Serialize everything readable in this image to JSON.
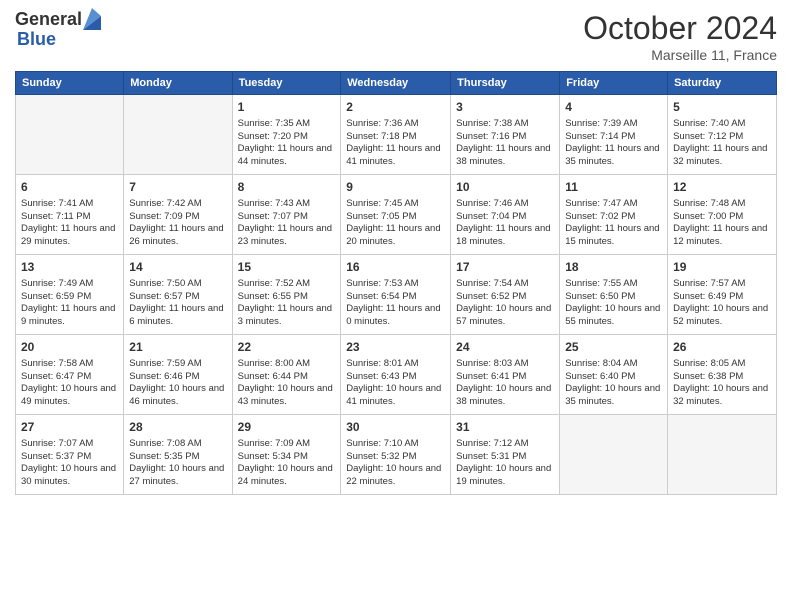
{
  "logo": {
    "general": "General",
    "blue": "Blue"
  },
  "header": {
    "title": "October 2024",
    "subtitle": "Marseille 11, France"
  },
  "weekdays": [
    "Sunday",
    "Monday",
    "Tuesday",
    "Wednesday",
    "Thursday",
    "Friday",
    "Saturday"
  ],
  "weeks": [
    [
      {
        "day": "",
        "sunrise": "",
        "sunset": "",
        "daylight": ""
      },
      {
        "day": "",
        "sunrise": "",
        "sunset": "",
        "daylight": ""
      },
      {
        "day": "1",
        "sunrise": "Sunrise: 7:35 AM",
        "sunset": "Sunset: 7:20 PM",
        "daylight": "Daylight: 11 hours and 44 minutes."
      },
      {
        "day": "2",
        "sunrise": "Sunrise: 7:36 AM",
        "sunset": "Sunset: 7:18 PM",
        "daylight": "Daylight: 11 hours and 41 minutes."
      },
      {
        "day": "3",
        "sunrise": "Sunrise: 7:38 AM",
        "sunset": "Sunset: 7:16 PM",
        "daylight": "Daylight: 11 hours and 38 minutes."
      },
      {
        "day": "4",
        "sunrise": "Sunrise: 7:39 AM",
        "sunset": "Sunset: 7:14 PM",
        "daylight": "Daylight: 11 hours and 35 minutes."
      },
      {
        "day": "5",
        "sunrise": "Sunrise: 7:40 AM",
        "sunset": "Sunset: 7:12 PM",
        "daylight": "Daylight: 11 hours and 32 minutes."
      }
    ],
    [
      {
        "day": "6",
        "sunrise": "Sunrise: 7:41 AM",
        "sunset": "Sunset: 7:11 PM",
        "daylight": "Daylight: 11 hours and 29 minutes."
      },
      {
        "day": "7",
        "sunrise": "Sunrise: 7:42 AM",
        "sunset": "Sunset: 7:09 PM",
        "daylight": "Daylight: 11 hours and 26 minutes."
      },
      {
        "day": "8",
        "sunrise": "Sunrise: 7:43 AM",
        "sunset": "Sunset: 7:07 PM",
        "daylight": "Daylight: 11 hours and 23 minutes."
      },
      {
        "day": "9",
        "sunrise": "Sunrise: 7:45 AM",
        "sunset": "Sunset: 7:05 PM",
        "daylight": "Daylight: 11 hours and 20 minutes."
      },
      {
        "day": "10",
        "sunrise": "Sunrise: 7:46 AM",
        "sunset": "Sunset: 7:04 PM",
        "daylight": "Daylight: 11 hours and 18 minutes."
      },
      {
        "day": "11",
        "sunrise": "Sunrise: 7:47 AM",
        "sunset": "Sunset: 7:02 PM",
        "daylight": "Daylight: 11 hours and 15 minutes."
      },
      {
        "day": "12",
        "sunrise": "Sunrise: 7:48 AM",
        "sunset": "Sunset: 7:00 PM",
        "daylight": "Daylight: 11 hours and 12 minutes."
      }
    ],
    [
      {
        "day": "13",
        "sunrise": "Sunrise: 7:49 AM",
        "sunset": "Sunset: 6:59 PM",
        "daylight": "Daylight: 11 hours and 9 minutes."
      },
      {
        "day": "14",
        "sunrise": "Sunrise: 7:50 AM",
        "sunset": "Sunset: 6:57 PM",
        "daylight": "Daylight: 11 hours and 6 minutes."
      },
      {
        "day": "15",
        "sunrise": "Sunrise: 7:52 AM",
        "sunset": "Sunset: 6:55 PM",
        "daylight": "Daylight: 11 hours and 3 minutes."
      },
      {
        "day": "16",
        "sunrise": "Sunrise: 7:53 AM",
        "sunset": "Sunset: 6:54 PM",
        "daylight": "Daylight: 11 hours and 0 minutes."
      },
      {
        "day": "17",
        "sunrise": "Sunrise: 7:54 AM",
        "sunset": "Sunset: 6:52 PM",
        "daylight": "Daylight: 10 hours and 57 minutes."
      },
      {
        "day": "18",
        "sunrise": "Sunrise: 7:55 AM",
        "sunset": "Sunset: 6:50 PM",
        "daylight": "Daylight: 10 hours and 55 minutes."
      },
      {
        "day": "19",
        "sunrise": "Sunrise: 7:57 AM",
        "sunset": "Sunset: 6:49 PM",
        "daylight": "Daylight: 10 hours and 52 minutes."
      }
    ],
    [
      {
        "day": "20",
        "sunrise": "Sunrise: 7:58 AM",
        "sunset": "Sunset: 6:47 PM",
        "daylight": "Daylight: 10 hours and 49 minutes."
      },
      {
        "day": "21",
        "sunrise": "Sunrise: 7:59 AM",
        "sunset": "Sunset: 6:46 PM",
        "daylight": "Daylight: 10 hours and 46 minutes."
      },
      {
        "day": "22",
        "sunrise": "Sunrise: 8:00 AM",
        "sunset": "Sunset: 6:44 PM",
        "daylight": "Daylight: 10 hours and 43 minutes."
      },
      {
        "day": "23",
        "sunrise": "Sunrise: 8:01 AM",
        "sunset": "Sunset: 6:43 PM",
        "daylight": "Daylight: 10 hours and 41 minutes."
      },
      {
        "day": "24",
        "sunrise": "Sunrise: 8:03 AM",
        "sunset": "Sunset: 6:41 PM",
        "daylight": "Daylight: 10 hours and 38 minutes."
      },
      {
        "day": "25",
        "sunrise": "Sunrise: 8:04 AM",
        "sunset": "Sunset: 6:40 PM",
        "daylight": "Daylight: 10 hours and 35 minutes."
      },
      {
        "day": "26",
        "sunrise": "Sunrise: 8:05 AM",
        "sunset": "Sunset: 6:38 PM",
        "daylight": "Daylight: 10 hours and 32 minutes."
      }
    ],
    [
      {
        "day": "27",
        "sunrise": "Sunrise: 7:07 AM",
        "sunset": "Sunset: 5:37 PM",
        "daylight": "Daylight: 10 hours and 30 minutes."
      },
      {
        "day": "28",
        "sunrise": "Sunrise: 7:08 AM",
        "sunset": "Sunset: 5:35 PM",
        "daylight": "Daylight: 10 hours and 27 minutes."
      },
      {
        "day": "29",
        "sunrise": "Sunrise: 7:09 AM",
        "sunset": "Sunset: 5:34 PM",
        "daylight": "Daylight: 10 hours and 24 minutes."
      },
      {
        "day": "30",
        "sunrise": "Sunrise: 7:10 AM",
        "sunset": "Sunset: 5:32 PM",
        "daylight": "Daylight: 10 hours and 22 minutes."
      },
      {
        "day": "31",
        "sunrise": "Sunrise: 7:12 AM",
        "sunset": "Sunset: 5:31 PM",
        "daylight": "Daylight: 10 hours and 19 minutes."
      },
      {
        "day": "",
        "sunrise": "",
        "sunset": "",
        "daylight": ""
      },
      {
        "day": "",
        "sunrise": "",
        "sunset": "",
        "daylight": ""
      }
    ]
  ]
}
